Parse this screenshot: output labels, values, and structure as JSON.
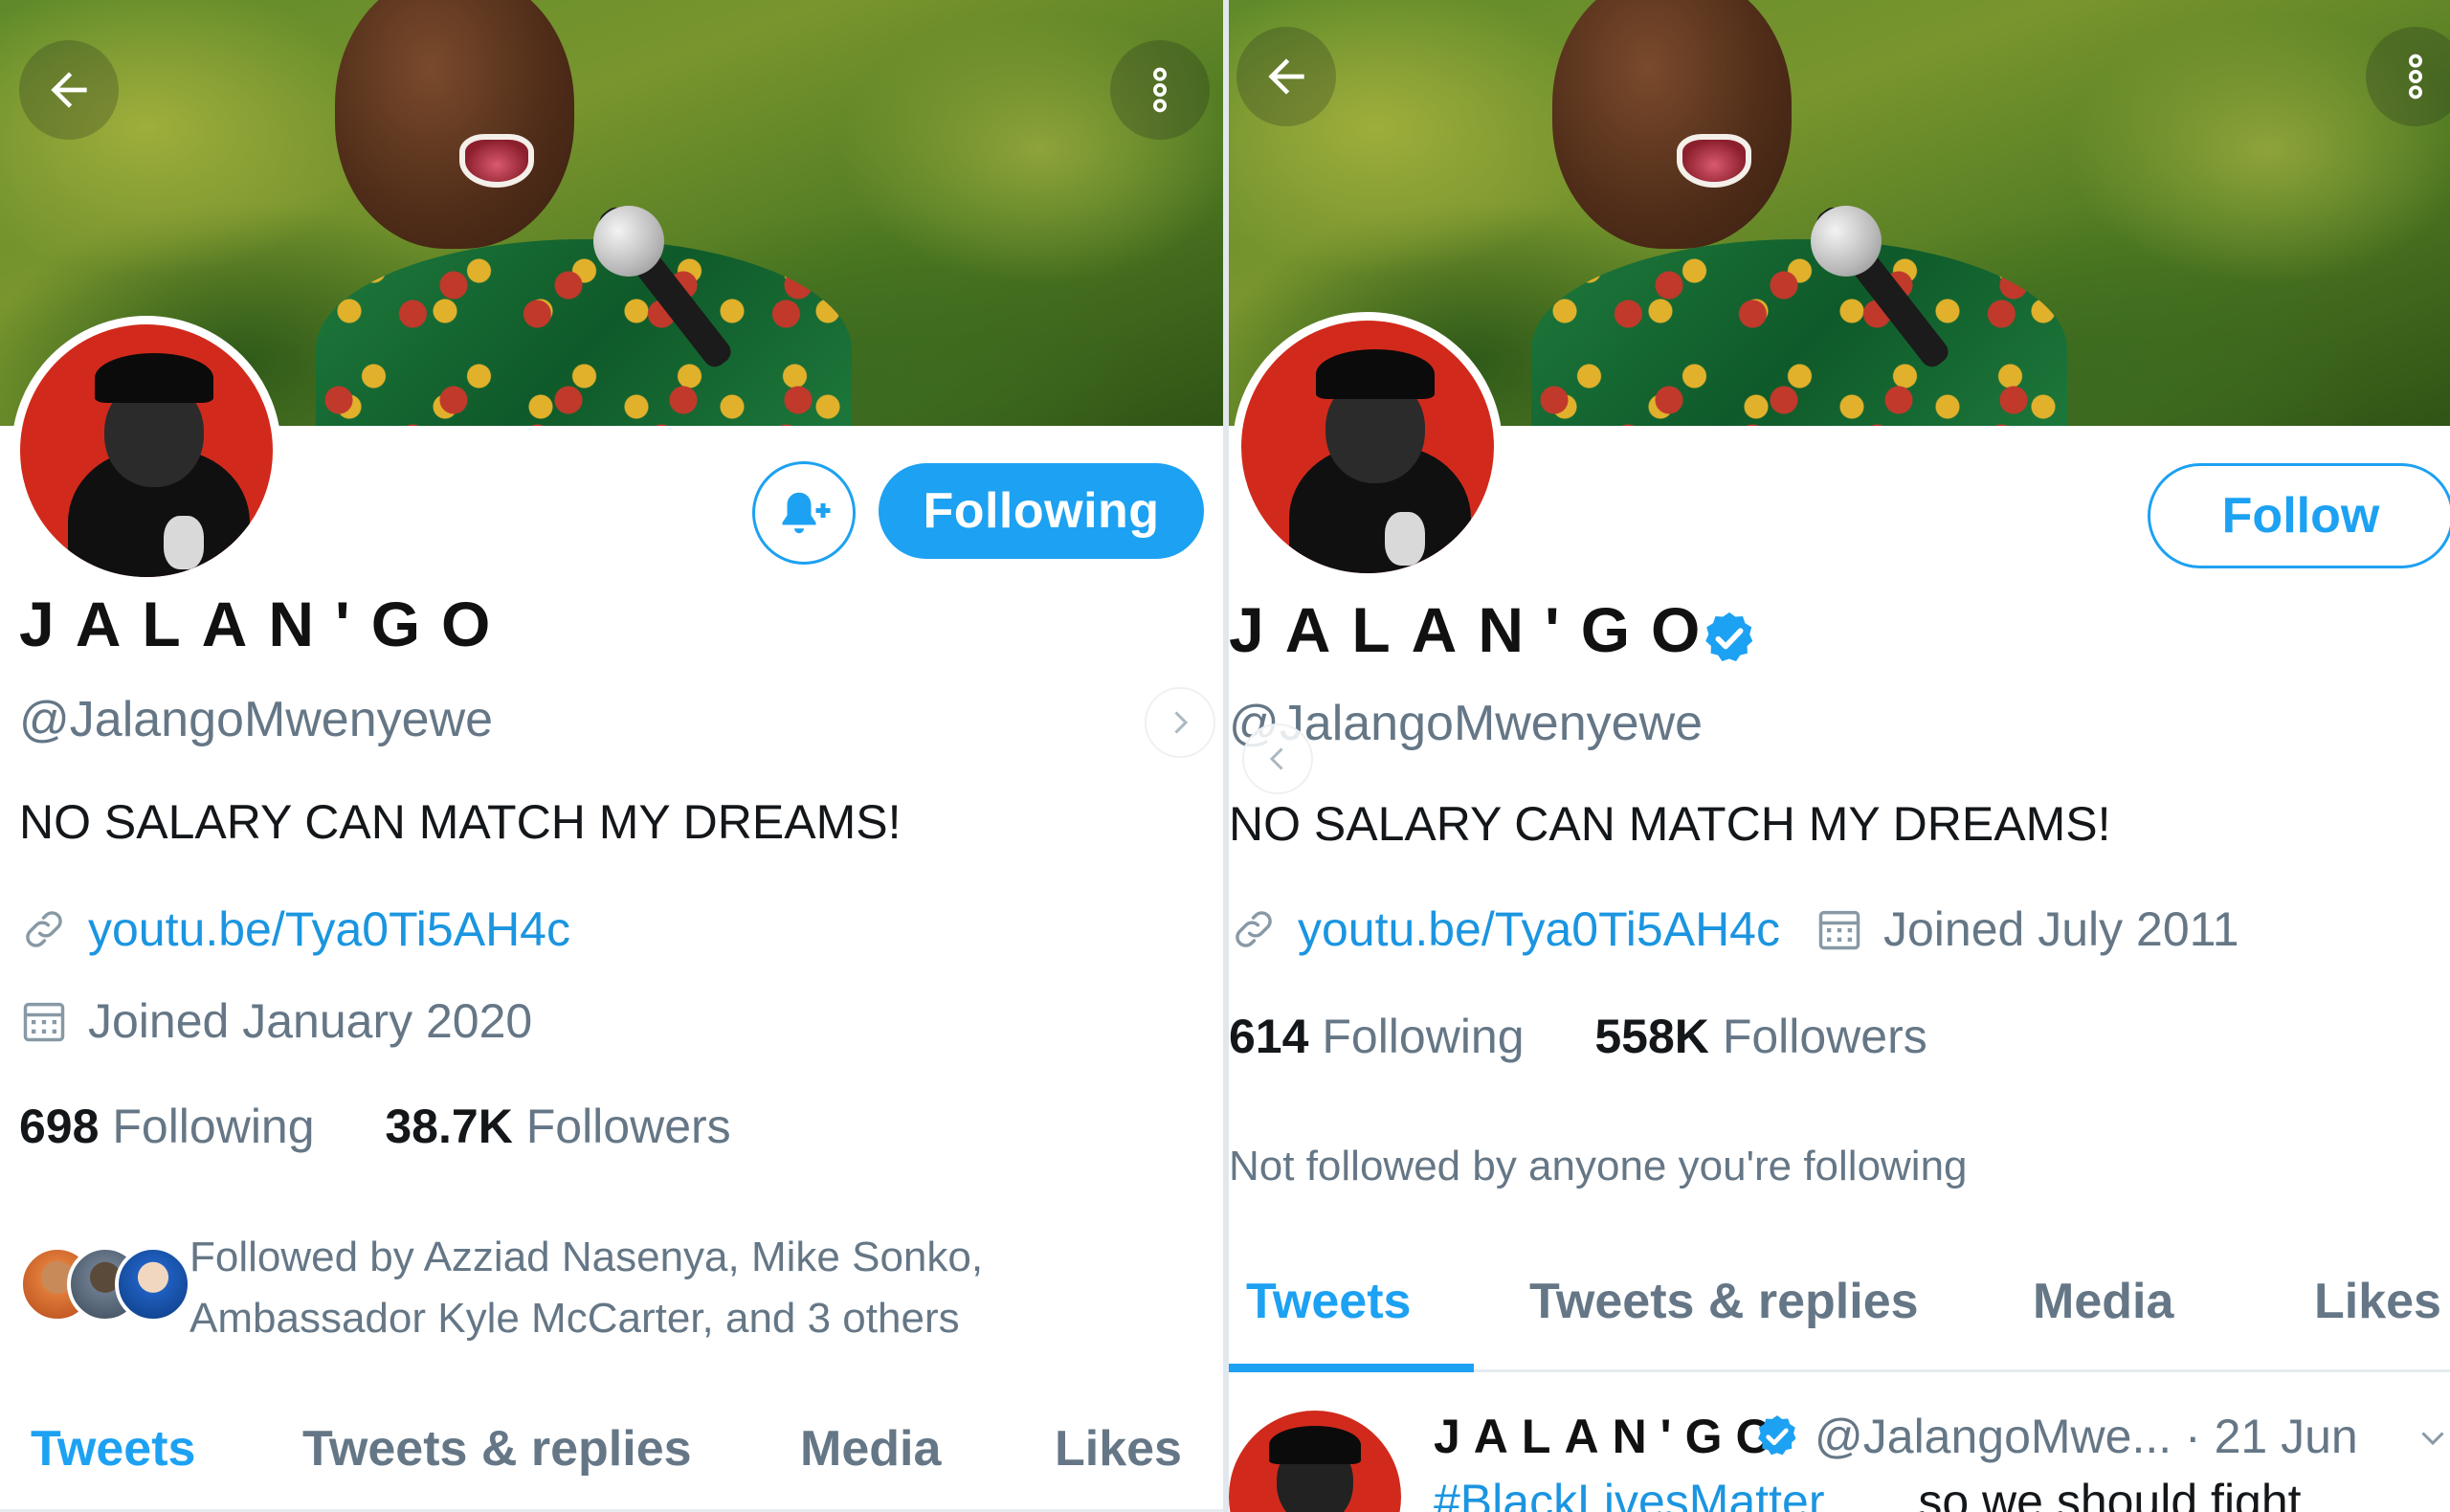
{
  "left": {
    "name": "JALAN'GO",
    "handle": "@JalangoMwenyewe",
    "bio": "NO SALARY CAN MATCH MY DREAMS!",
    "link": "youtu.be/Tya0Ti5AH4c",
    "joined": "Joined January 2020",
    "following_count": "698",
    "following_label": "Following",
    "followers_count": "38.7K",
    "followers_label": "Followers",
    "follow_button": "Following",
    "followed_by_line1": "Followed by Azziad Nasenya, Mike Sonko,",
    "followed_by_line2": "Ambassador Kyle McCarter, and 3 others",
    "tabs": [
      "Tweets",
      "Tweets & replies",
      "Media",
      "Likes"
    ],
    "active_tab": "Tweets"
  },
  "right": {
    "name": "JALAN'GO",
    "verified": true,
    "handle": "@JalangoMwenyewe",
    "bio": "NO SALARY CAN MATCH MY DREAMS!",
    "link": "youtu.be/Tya0Ti5AH4c",
    "joined": "Joined July 2011",
    "following_count": "614",
    "following_label": "Following",
    "followers_count": "558K",
    "followers_label": "Followers",
    "follow_button": "Follow",
    "not_followed": "Not followed by anyone you're following",
    "tabs": [
      "Tweets",
      "Tweets & replies",
      "Media",
      "Likes"
    ],
    "active_tab": "Tweets",
    "tweet": {
      "name": "JALAN'GO",
      "handle_time": "@JalangoMwe... · 21 Jun",
      "hashtag": "#BlackLivesMatter",
      "text": "so we should fight"
    }
  },
  "colors": {
    "accent": "#1da1f2",
    "link": "#1b95e0",
    "secondary_text": "#657786",
    "avatar_bg": "#d12a1c"
  },
  "icons": [
    "back-arrow-icon",
    "more-vertical-icon",
    "bell-plus-icon",
    "link-icon",
    "calendar-icon",
    "verified-badge-icon",
    "chevron-right-icon",
    "chevron-left-icon",
    "chevron-down-icon"
  ]
}
